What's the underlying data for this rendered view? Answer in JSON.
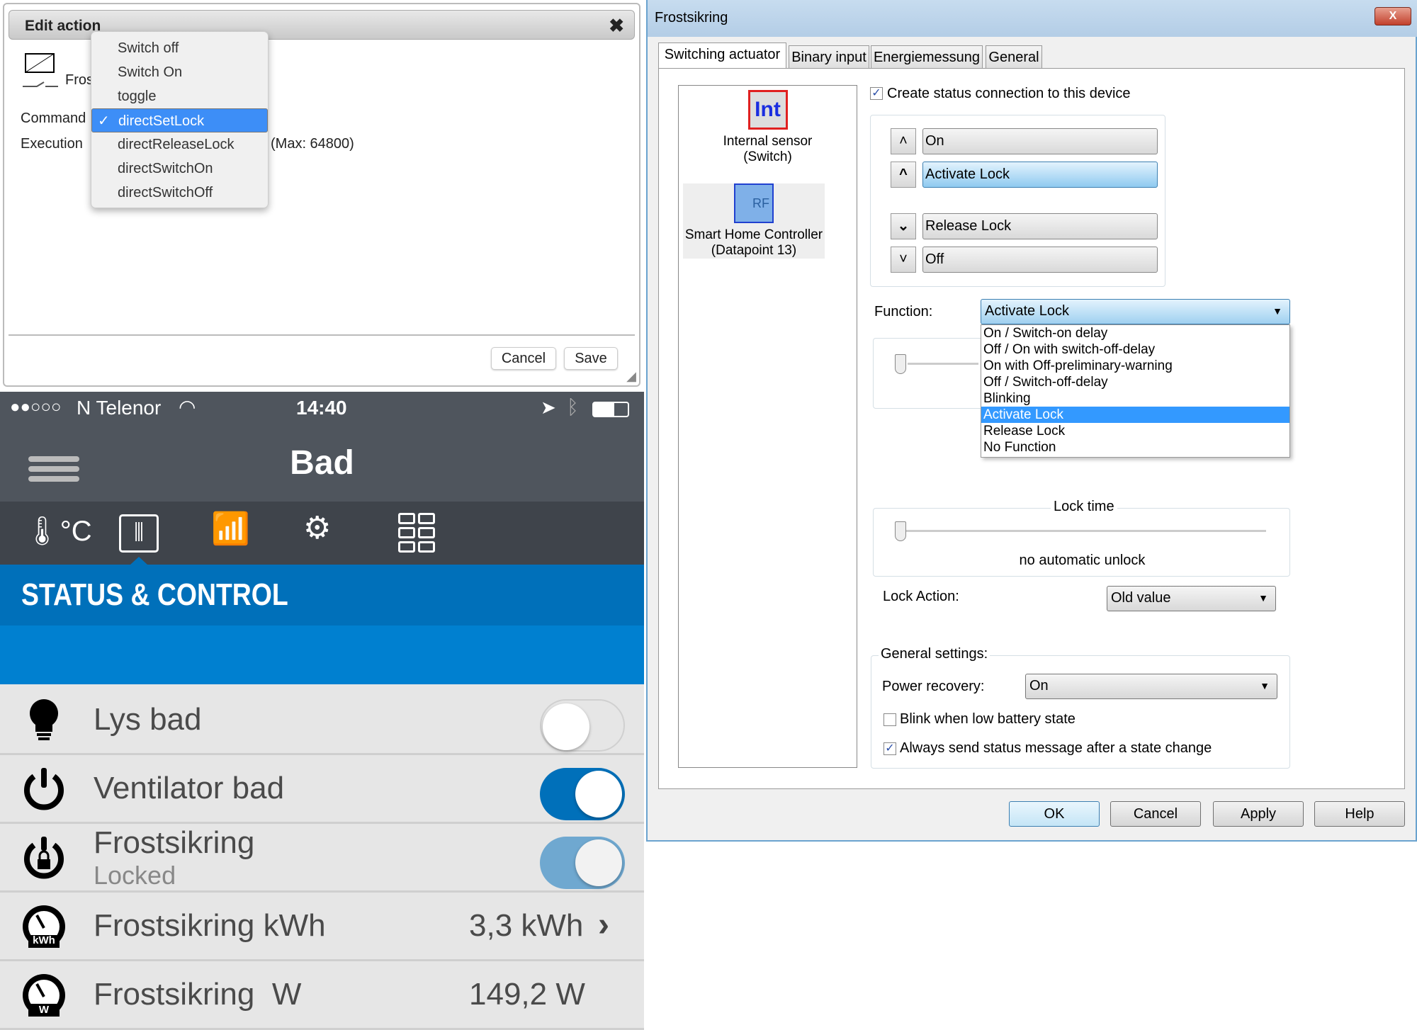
{
  "edit_action": {
    "title": "Edit action",
    "device_name_partial": "Fros",
    "command_label": "Command",
    "execution_label": "Execution",
    "max_hint": "(Max: 64800)",
    "command_options": [
      "Switch off",
      "Switch On",
      "toggle",
      "directSetLock",
      "directReleaseLock",
      "directSwitchOn",
      "directSwitchOff"
    ],
    "selected_command": "directSetLock",
    "check_mark": "✓",
    "cancel": "Cancel",
    "save": "Save"
  },
  "phone": {
    "status_bar": {
      "signal": "●●○○○",
      "carrier": "N Telenor",
      "time": "14:40"
    },
    "title": "Bad",
    "section": "STATUS & CONTROL",
    "temp_icon_text": "°C",
    "rows": [
      {
        "name": "Lys bad",
        "icon": "lightbulb-icon",
        "toggle": false
      },
      {
        "name": "Ventilator bad",
        "icon": "power-icon",
        "toggle": true
      },
      {
        "name": "Frostsikring",
        "sub": "Locked",
        "icon": "power-lock-icon",
        "toggle": true,
        "toggle_disabled": true
      },
      {
        "name": "Frostsikring kWh",
        "icon": "meter-kwh-icon",
        "value": "3,3 kWh",
        "badge": "kWh"
      },
      {
        "name": "Frostsikring  W",
        "icon": "meter-w-icon",
        "value": "149,2 W",
        "badge": "W"
      }
    ],
    "colors": {
      "header": "#4f555d",
      "accent": "#0070ba",
      "toggle_on": "#0070ba",
      "toggle_disabled": "#6fa8d0"
    }
  },
  "dialog": {
    "title": "Frostsikring",
    "close": "X",
    "tabs": [
      "Switching actuator",
      "Binary input",
      "Energiemessung",
      "General"
    ],
    "devices": [
      {
        "icon_text": "Int",
        "label1": "Internal sensor",
        "label2": "(Switch)"
      },
      {
        "icon_text": "RF",
        "label1": "Smart Home Controller",
        "label2": "(Datapoint 13)"
      }
    ],
    "create_status": "Create status connection to this device",
    "create_status_checked": true,
    "buttons": [
      "On",
      "Activate Lock",
      "Release Lock",
      "Off"
    ],
    "function_label": "Function:",
    "function_value": "Activate Lock",
    "function_options": [
      "On / Switch-on delay",
      "Off / On with switch-off-delay",
      "On with Off-preliminary-warning",
      "Off / Switch-off-delay",
      "Blinking",
      "Activate Lock",
      "Release Lock",
      "No Function"
    ],
    "lock_time_legend": "Lock time",
    "lock_time_value": "no automatic unlock",
    "lock_action_label": "Lock Action:",
    "lock_action_value": "Old value",
    "general_legend": "General settings:",
    "power_recovery_label": "Power recovery:",
    "power_recovery_value": "On",
    "blink_label": "Blink when low battery state",
    "blink_checked": false,
    "always_send_label": "Always send status message after a state change",
    "always_send_checked": true,
    "ok": "OK",
    "cancel": "Cancel",
    "apply": "Apply",
    "help": "Help"
  }
}
